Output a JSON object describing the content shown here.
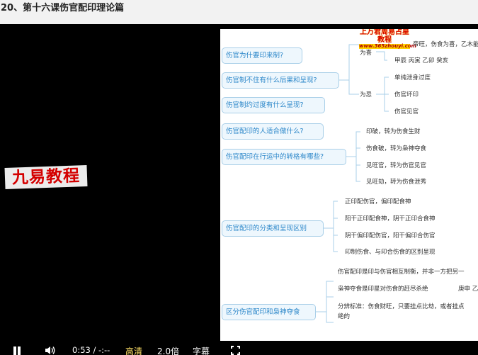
{
  "page_title": "20、第十六课伤官配印理论篇",
  "watermark": "九易教程",
  "slide": {
    "logo_line1": "上万君周易占星教程",
    "logo_line2": "www.365zhouyi.com",
    "top_fragment": "帝旺，伤食为喜，乙木能",
    "nodes": [
      "伤官为什要印来制?",
      "伤官制不住有什么后果和呈现?",
      "伤官制约过度有什么呈现?",
      "伤官配印的人适合做什么?",
      "伤官配印在行运中的转格有哪些?",
      "伤官配印的分类和呈现区别",
      "区分伤官配印和枭神夺食"
    ],
    "leaves": {
      "wei_xi": "为喜",
      "wei_ji": "为忌",
      "jiachen": "甲辰 丙寅 乙卯 癸亥",
      "danchun": "单纯泄身过度",
      "shangguan_huaiyin": "伤官坏印",
      "shangguan_jianguan": "伤官见官",
      "yinpo": "印破，转为伤食生财",
      "shangshipo": "伤食破，转为枭神夺食",
      "jianwangguan": "见旺官，转为伤官见官",
      "jianwangjie": "见旺劫，转为伤食泄秀",
      "zhengyin": "正印配伤官，偏印配食神",
      "yanggan_zheng": "阳干正印配食神，阴干正印合食神",
      "yingan_pian": "阴干偏印配伤官，阳干偏印合伤官",
      "yinzhi": "印制伤食、与印合伤食的区别呈现",
      "shangguan_peiyin_desc": "伤官配印是印与伤官相互制衡，并非一方把另一",
      "xiaoshen": "枭神夺食是印星对伤食的赶尽杀绝",
      "gengshen": "庚申 乙",
      "fenbian": "分辨标准：伤食财旺，只要挂点比劫，或者挂点",
      "jue": "绝的"
    }
  },
  "controls": {
    "time": "0:53 / -:--",
    "quality": "高清",
    "speed": "2.0倍",
    "subtitle": "字幕"
  }
}
